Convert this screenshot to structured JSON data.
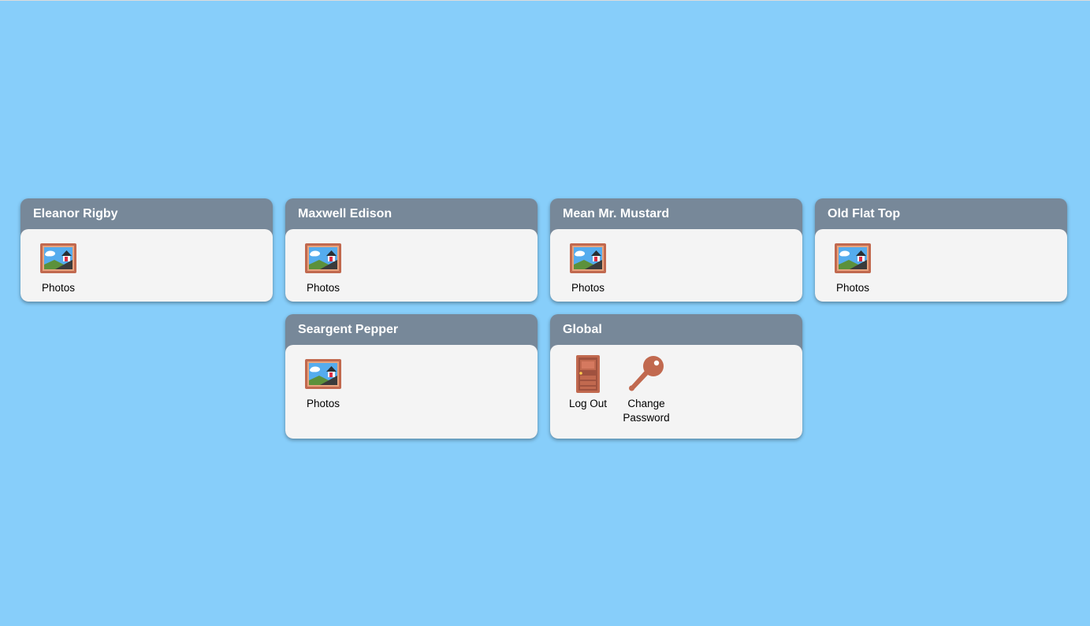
{
  "colors": {
    "background": "#87cefa",
    "card_header": "#778899",
    "card_body": "#f4f4f4",
    "accent_terracotta": "#c1694f"
  },
  "groups": [
    {
      "title": "Eleanor Rigby",
      "apps": [
        {
          "label": "Photos",
          "icon": "photo-frame-icon"
        }
      ]
    },
    {
      "title": "Maxwell Edison",
      "apps": [
        {
          "label": "Photos",
          "icon": "photo-frame-icon"
        }
      ]
    },
    {
      "title": "Mean Mr. Mustard",
      "apps": [
        {
          "label": "Photos",
          "icon": "photo-frame-icon"
        }
      ]
    },
    {
      "title": "Old Flat Top",
      "apps": [
        {
          "label": "Photos",
          "icon": "photo-frame-icon"
        }
      ]
    },
    {
      "title": "Seargent Pepper",
      "apps": [
        {
          "label": "Photos",
          "icon": "photo-frame-icon"
        }
      ]
    },
    {
      "title": "Global",
      "apps": [
        {
          "label": "Log Out",
          "icon": "door-icon"
        },
        {
          "label": "Change Password",
          "icon": "key-icon"
        }
      ]
    }
  ]
}
